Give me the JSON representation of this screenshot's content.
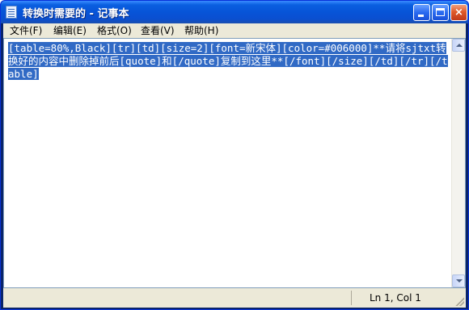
{
  "window": {
    "title": "转换时需要的 - 记事本"
  },
  "caption_buttons": {
    "minimize_icon": "minimize-icon",
    "maximize_icon": "maximize-icon",
    "close_label": "×"
  },
  "menu": {
    "items": [
      {
        "label": "文件(F)"
      },
      {
        "label": "编辑(E)"
      },
      {
        "label": "格式(O)"
      },
      {
        "label": "查看(V)"
      },
      {
        "label": "帮助(H)"
      }
    ]
  },
  "editor": {
    "content": "[table=80%,Black][tr][td][size=2][font=新宋体][color=#006000]**请将sjtxt转换好的内容中删除掉前后[quote]和[/quote]复制到这里**[/font][/size][/td][/tr][/table]",
    "selected": true
  },
  "statusbar": {
    "position": "Ln 1, Col 1"
  },
  "colors": {
    "titlebar": "#0a5fe0",
    "selection": "#316ac5",
    "menubar": "#ece9d8"
  }
}
